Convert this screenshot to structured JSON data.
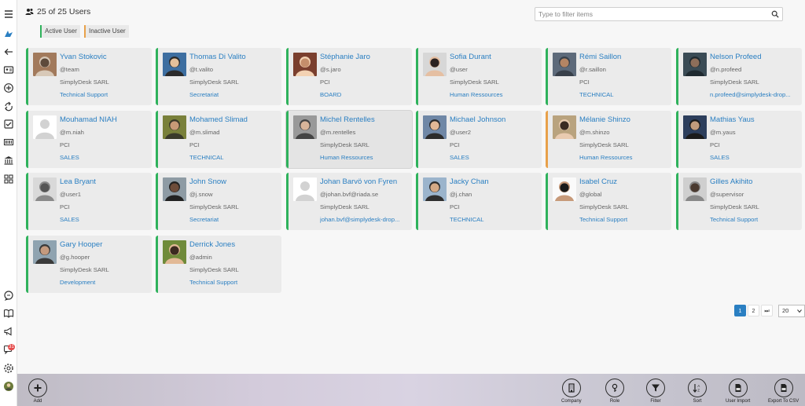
{
  "header": {
    "title": "25 of 25 Users"
  },
  "search": {
    "placeholder": "Type to filter items"
  },
  "legend": {
    "active": "Active User",
    "inactive": "Inactive User"
  },
  "colors": {
    "active": "#2fb25c",
    "inactive": "#e8a14a",
    "link": "#2a7fc2",
    "badge": "#e54b4b"
  },
  "rail": {
    "icons": [
      "menu-icon",
      "logo-icon",
      "back-arrow-icon",
      "id-card-icon",
      "add-circle-icon",
      "sync-icon",
      "checklist-icon",
      "barcode-icon",
      "bank-icon",
      "grid-icon",
      "chat-icon",
      "book-icon",
      "megaphone-icon",
      "messages-icon",
      "settings-icon",
      "user-avatar-icon"
    ],
    "badge": "31"
  },
  "users": [
    {
      "name": "Yvan Stokovic",
      "login": "@team",
      "company": "SimplyDesk SARL",
      "role": "Technical Support",
      "status": "active",
      "avatar": "photo"
    },
    {
      "name": "Thomas Di Valito",
      "login": "@t.valito",
      "company": "SimplyDesk SARL",
      "role": "Secretariat",
      "status": "active",
      "avatar": "photo"
    },
    {
      "name": "Stéphanie Jaro",
      "login": "@s.jaro",
      "company": "PCI",
      "role": "BOARD",
      "status": "active",
      "avatar": "photo"
    },
    {
      "name": "Sofia Durant",
      "login": "@user",
      "company": "SimplyDesk SARL",
      "role": "Human Ressources",
      "status": "active",
      "avatar": "photo"
    },
    {
      "name": "Rémi Saillon",
      "login": "@r.saillon",
      "company": "PCI",
      "role": "TECHNICAL",
      "status": "active",
      "avatar": "photo"
    },
    {
      "name": "Nelson Profeed",
      "login": "@n.profeed",
      "company": "SimplyDesk SARL",
      "role": "n.profeed@simplydesk-drop...",
      "status": "active",
      "avatar": "photo"
    },
    {
      "name": "Mouhamad NIAH",
      "login": "@m.niah",
      "company": "PCI",
      "role": "SALES",
      "status": "active",
      "avatar": "placeholder"
    },
    {
      "name": "Mohamed Slimad",
      "login": "@m.slimad",
      "company": "PCI",
      "role": "TECHNICAL",
      "status": "active",
      "avatar": "photo"
    },
    {
      "name": "Michel Rentelles",
      "login": "@m.rentelles",
      "company": "SimplyDesk SARL",
      "role": "Human Ressources",
      "status": "active",
      "avatar": "photo",
      "selected": true
    },
    {
      "name": "Michael Johnson",
      "login": "@user2",
      "company": "PCI",
      "role": "SALES",
      "status": "active",
      "avatar": "photo"
    },
    {
      "name": "Mélanie Shinzo",
      "login": "@m.shinzo",
      "company": "SimplyDesk SARL",
      "role": "Human Ressources",
      "status": "inactive",
      "avatar": "photo"
    },
    {
      "name": "Mathias Yaus",
      "login": "@m.yaus",
      "company": "PCI",
      "role": "SALES",
      "status": "active",
      "avatar": "photo"
    },
    {
      "name": "Lea Bryant",
      "login": "@user1",
      "company": "PCI",
      "role": "SALES",
      "status": "active",
      "avatar": "photo"
    },
    {
      "name": "John Snow",
      "login": "@j.snow",
      "company": "SimplyDesk SARL",
      "role": "Secretariat",
      "status": "active",
      "avatar": "photo"
    },
    {
      "name": "Johan Barvö von Fyren",
      "login": "@johan.bvf@riada.se",
      "company": "SimplyDesk SARL",
      "role": "johan.bvf@simplydesk-drop...",
      "status": "active",
      "avatar": "placeholder"
    },
    {
      "name": "Jacky Chan",
      "login": "@j.chan",
      "company": "PCI",
      "role": "TECHNICAL",
      "status": "active",
      "avatar": "photo"
    },
    {
      "name": "Isabel Cruz",
      "login": "@global",
      "company": "SimplyDesk SARL",
      "role": "Technical Support",
      "status": "active",
      "avatar": "photo"
    },
    {
      "name": "Gilles Akihito",
      "login": "@supervisor",
      "company": "SimplyDesk SARL",
      "role": "Technical Support",
      "status": "active",
      "avatar": "photo"
    },
    {
      "name": "Gary Hooper",
      "login": "@g.hooper",
      "company": "SimplyDesk SARL",
      "role": "Development",
      "status": "active",
      "avatar": "photo"
    },
    {
      "name": "Derrick Jones",
      "login": "@admin",
      "company": "SimplyDesk SARL",
      "role": "Technical Support",
      "status": "active",
      "avatar": "photo"
    }
  ],
  "pagination": {
    "pages": [
      "1",
      "2"
    ],
    "current": "1",
    "next_label": "⏭",
    "page_size": "20"
  },
  "toolbar": {
    "add": "Add",
    "company": "Company",
    "role": "Role",
    "filter": "Filter",
    "sort": "Sort",
    "user_import": "User Import",
    "export_csv": "Export To CSV"
  }
}
